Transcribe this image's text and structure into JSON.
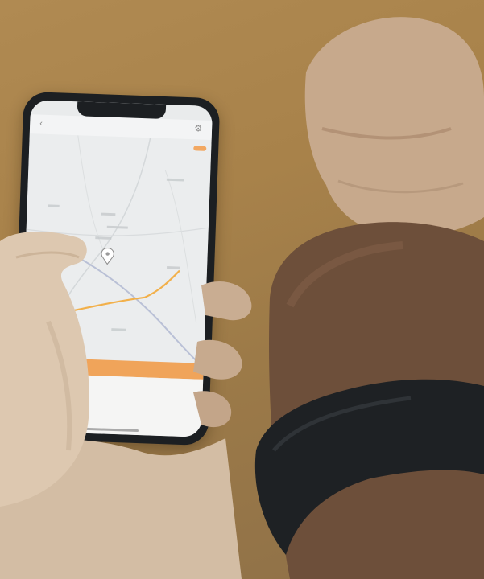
{
  "scene": {
    "background_color": "#a8844c",
    "phone_frame_color": "#1c1f22",
    "accent_color": "#f0a45a",
    "route_color": "#f2b04a",
    "road_color": "#b9c0d6",
    "wristband_color": "#1e2124",
    "skin_light": "#d9c3a8",
    "skin_dark": "#6d4f3a"
  },
  "phone": {
    "status_bar": {
      "time": "",
      "icons": ""
    },
    "nav_bar": {
      "title": "",
      "back_icon": "chevron-left-icon",
      "settings_icon": "gear-icon"
    },
    "map": {
      "pin_icon": "location-pin-icon",
      "record_chip": ""
    },
    "track_info": {
      "distance": "",
      "duration": "",
      "speed": ""
    },
    "bottom_panel": {
      "description": "",
      "left_button": "",
      "right_button": ""
    }
  },
  "wristband": {
    "device": "fitness-band"
  }
}
